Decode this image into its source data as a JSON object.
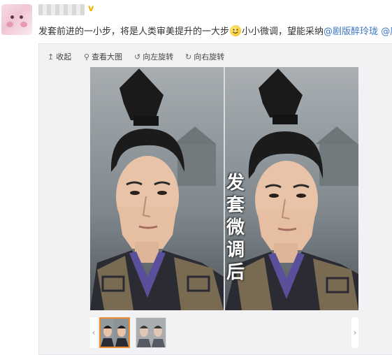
{
  "post": {
    "verified_badge": "v",
    "text_part1": "发套前进的一小步，将是人类审美提升的一大步",
    "emoji": "smile-emoji",
    "text_part2": "小小微调，望能采纳",
    "mention1": "@剧版醉玲珑",
    "mention2": "@唐丽君"
  },
  "toolbar": {
    "collapse": "收起",
    "view_large": "查看大图",
    "rotate_left": "向左旋转",
    "rotate_right": "向右旋转"
  },
  "image": {
    "caption": "发套微调后"
  },
  "colors": {
    "mention": "#3a73c4",
    "selected_thumb_border": "#f08a2a",
    "card_bg": "#f2f2f5"
  }
}
